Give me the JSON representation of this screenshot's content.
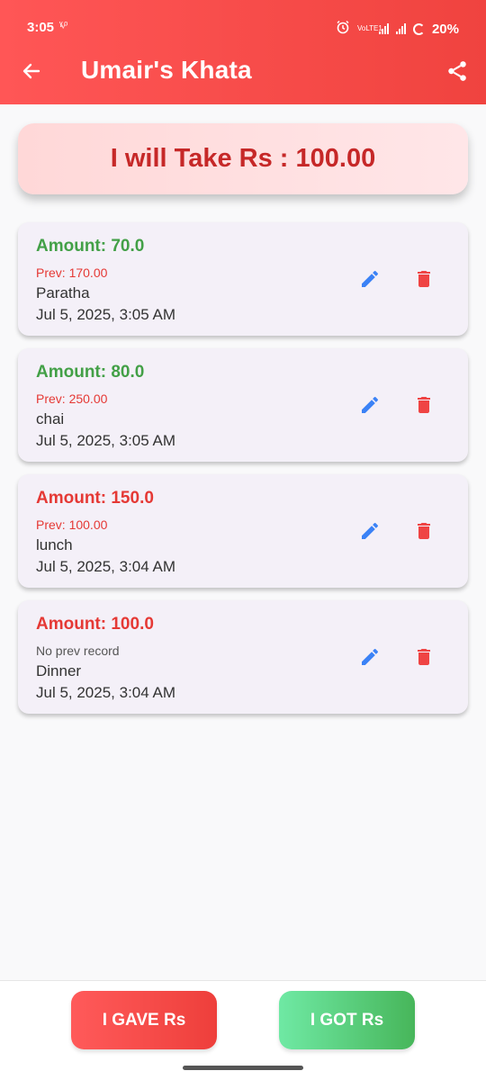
{
  "status_bar": {
    "time": "3:05",
    "indicator_glyph": "ˠᵥᵒ",
    "alarm_icon": "alarm-icon",
    "network_label": "VoLTE1",
    "battery": "20%"
  },
  "app_bar": {
    "title": "Umair's Khata",
    "back_icon": "arrow-left-icon",
    "share_icon": "share-icon"
  },
  "summary": {
    "text": "I will Take Rs : 100.00"
  },
  "colors": {
    "header": "#f44b47",
    "positive": "#43a047",
    "negative": "#e53935",
    "edit": "#3b82f6",
    "delete": "#ef4444",
    "summary_text": "#c62828"
  },
  "entries": [
    {
      "amount": "Amount: 70.0",
      "type": "got",
      "prev": "Prev: 170.00",
      "prev_type": "record",
      "description": "Paratha",
      "date": "Jul 5, 2025, 3:05 AM"
    },
    {
      "amount": "Amount: 80.0",
      "type": "got",
      "prev": "Prev: 250.00",
      "prev_type": "record",
      "description": "chai",
      "date": "Jul 5, 2025, 3:05 AM"
    },
    {
      "amount": "Amount: 150.0",
      "type": "gave",
      "prev": "Prev: 100.00",
      "prev_type": "record",
      "description": "lunch",
      "date": "Jul 5, 2025, 3:04 AM"
    },
    {
      "amount": "Amount: 100.0",
      "type": "gave",
      "prev": "No prev record",
      "prev_type": "none",
      "description": "Dinner",
      "date": "Jul 5, 2025, 3:04 AM"
    }
  ],
  "actions": {
    "gave_label": "I GAVE Rs",
    "got_label": "I GOT Rs"
  }
}
